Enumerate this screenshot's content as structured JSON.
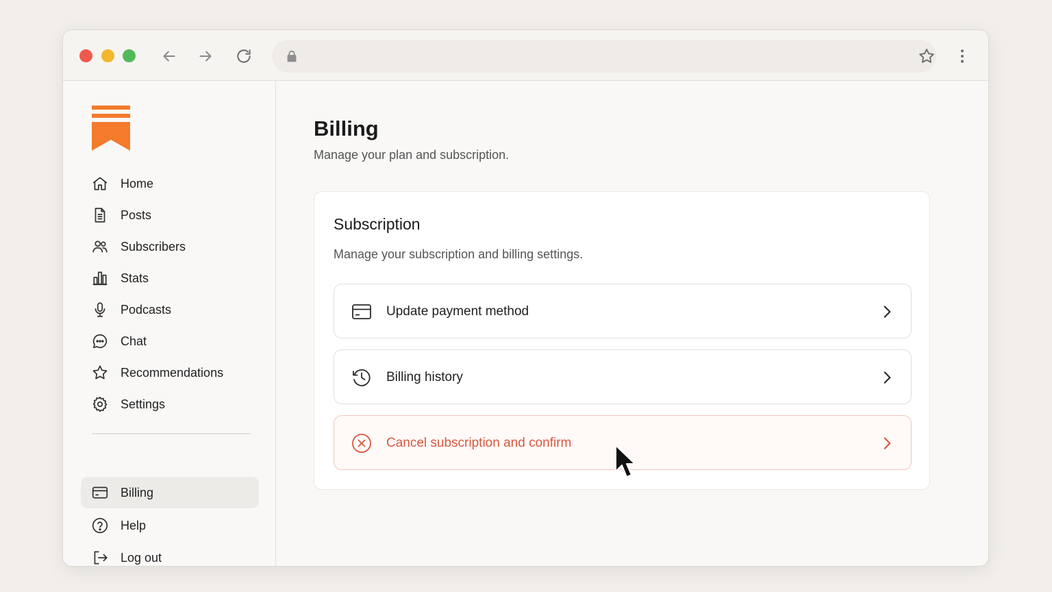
{
  "browser": {
    "url_value": "",
    "colors": {
      "close": "#ee5a4f",
      "minimize": "#f3b72c",
      "maximize": "#53b95a"
    }
  },
  "sidebar": {
    "logo_color": "#f47a2c",
    "items": [
      {
        "label": "Home",
        "icon": "home-icon"
      },
      {
        "label": "Posts",
        "icon": "document-icon"
      },
      {
        "label": "Subscribers",
        "icon": "users-icon"
      },
      {
        "label": "Stats",
        "icon": "bar-chart-icon"
      },
      {
        "label": "Podcasts",
        "icon": "microphone-icon"
      },
      {
        "label": "Chat",
        "icon": "chat-bubble-icon"
      },
      {
        "label": "Recommendations",
        "icon": "star-icon"
      },
      {
        "label": "Settings",
        "icon": "gear-icon"
      }
    ],
    "bottom_items": [
      {
        "label": "Billing",
        "icon": "credit-card-icon",
        "active": true
      },
      {
        "label": "Help",
        "icon": "help-circle-icon"
      },
      {
        "label": "Log out",
        "icon": "logout-icon"
      }
    ]
  },
  "main": {
    "title": "Billing",
    "subtitle": "Manage your plan and subscription.",
    "card": {
      "title": "Subscription",
      "subtitle": "Manage your subscription and billing settings.",
      "rows": [
        {
          "label": "Update payment method",
          "icon": "credit-card-icon"
        },
        {
          "label": "Billing history",
          "icon": "history-clock-icon"
        },
        {
          "label": "Cancel subscription and confirm",
          "icon": "cancel-circle-icon",
          "danger_color": "#d9573c"
        }
      ]
    }
  }
}
